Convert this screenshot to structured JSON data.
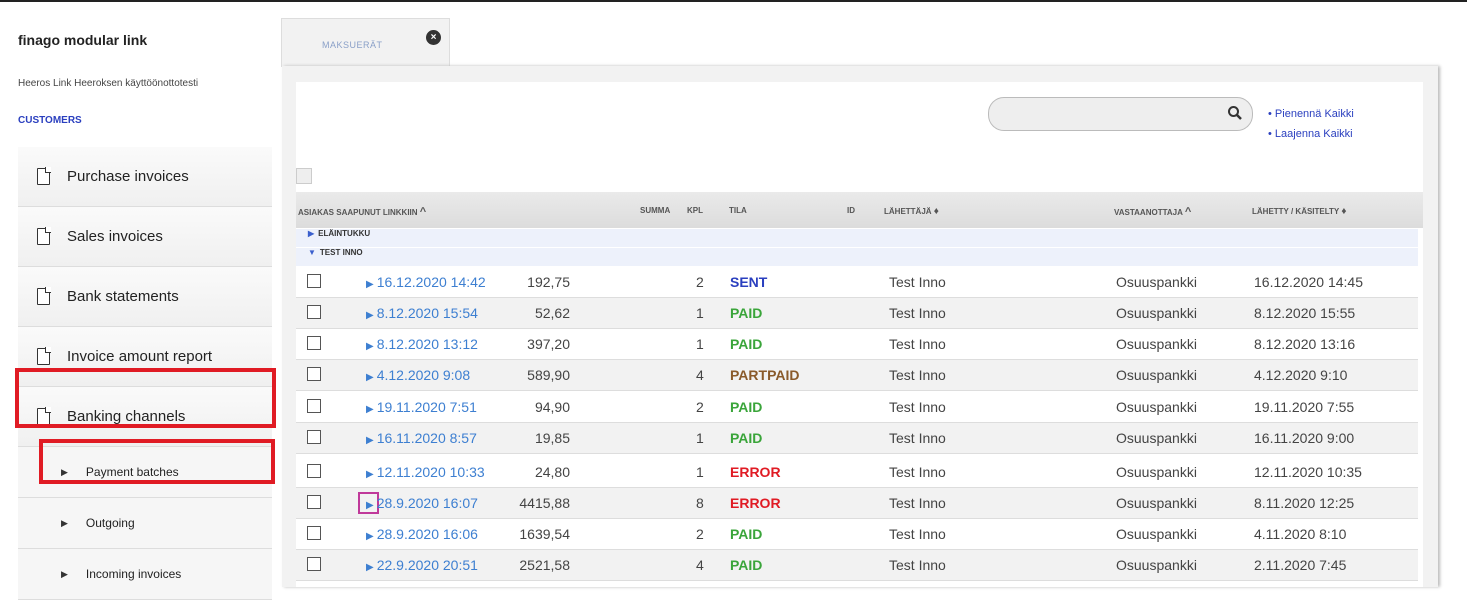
{
  "app": {
    "brand": "finago modular link",
    "subtitle": "Heeros Link Heeroksen käyttöönottotesti",
    "customers": "CUSTOMERS"
  },
  "sidebar": {
    "items": [
      {
        "label": "Purchase invoices"
      },
      {
        "label": "Sales invoices"
      },
      {
        "label": "Bank statements"
      },
      {
        "label": "Invoice amount report"
      },
      {
        "label": "Banking channels"
      }
    ],
    "subitems": [
      {
        "label": "Payment batches"
      },
      {
        "label": "Outgoing"
      },
      {
        "label": "Incoming invoices"
      }
    ]
  },
  "tab": {
    "label": "MAKSUERÄT"
  },
  "search": {
    "placeholder": ""
  },
  "links": {
    "collapse": "Pienennä Kaikki",
    "expand": "Laajenna Kaikki"
  },
  "table": {
    "headers": {
      "arrived": "ASIAKAS SAAPUNUT LINKKIIN",
      "sum": "SUMMA",
      "kpl": "KPL",
      "tila": "TILA",
      "id": "ID",
      "sender": "LÄHETTÄJÄ",
      "receiver": "VASTAANOTTAJA",
      "handled": "LÄHETTY / KÄSITELTY"
    },
    "groups": [
      "ELÄINTUKKU",
      "TEST INNO"
    ],
    "rows": [
      {
        "date": "16.12.2020 14:42",
        "sum": "192,75",
        "kpl": "2",
        "tila": "SENT",
        "tila_color": "#2a3fbf",
        "sender": "Test Inno",
        "receiver": "Osuuspankki",
        "handled": "16.12.2020 14:45"
      },
      {
        "date": "8.12.2020 15:54",
        "sum": "52,62",
        "kpl": "1",
        "tila": "PAID",
        "tila_color": "#3aa53a",
        "sender": "Test Inno",
        "receiver": "Osuuspankki",
        "handled": "8.12.2020 15:55"
      },
      {
        "date": "8.12.2020 13:12",
        "sum": "397,20",
        "kpl": "1",
        "tila": "PAID",
        "tila_color": "#3aa53a",
        "sender": "Test Inno",
        "receiver": "Osuuspankki",
        "handled": "8.12.2020 13:16"
      },
      {
        "date": "4.12.2020 9:08",
        "sum": "589,90",
        "kpl": "4",
        "tila": "PARTPAID",
        "tila_color": "#8a5a2a",
        "sender": "Test Inno",
        "receiver": "Osuuspankki",
        "handled": "4.12.2020 9:10"
      },
      {
        "date": "19.11.2020 7:51",
        "sum": "94,90",
        "kpl": "2",
        "tila": "PAID",
        "tila_color": "#3aa53a",
        "sender": "Test Inno",
        "receiver": "Osuuspankki",
        "handled": "19.11.2020 7:55"
      },
      {
        "date": "16.11.2020 8:57",
        "sum": "19,85",
        "kpl": "1",
        "tila": "PAID",
        "tila_color": "#3aa53a",
        "sender": "Test Inno",
        "receiver": "Osuuspankki",
        "handled": "16.11.2020 9:00"
      },
      {
        "date": "12.11.2020 10:33",
        "sum": "24,80",
        "kpl": "1",
        "tila": "ERROR",
        "tila_color": "#e01b24",
        "sender": "Test Inno",
        "receiver": "Osuuspankki",
        "handled": "12.11.2020 10:35"
      },
      {
        "date": "28.9.2020 16:07",
        "sum": "4415,88",
        "kpl": "8",
        "tila": "ERROR",
        "tila_color": "#e01b24",
        "sender": "Test Inno",
        "receiver": "Osuuspankki",
        "handled": "8.11.2020 12:25"
      },
      {
        "date": "28.9.2020 16:06",
        "sum": "1639,54",
        "kpl": "2",
        "tila": "PAID",
        "tila_color": "#3aa53a",
        "sender": "Test Inno",
        "receiver": "Osuuspankki",
        "handled": "4.11.2020 8:10"
      },
      {
        "date": "22.9.2020 20:51",
        "sum": "2521,58",
        "kpl": "4",
        "tila": "PAID",
        "tila_color": "#3aa53a",
        "sender": "Test Inno",
        "receiver": "Osuuspankki",
        "handled": "2.11.2020 7:45"
      }
    ]
  }
}
